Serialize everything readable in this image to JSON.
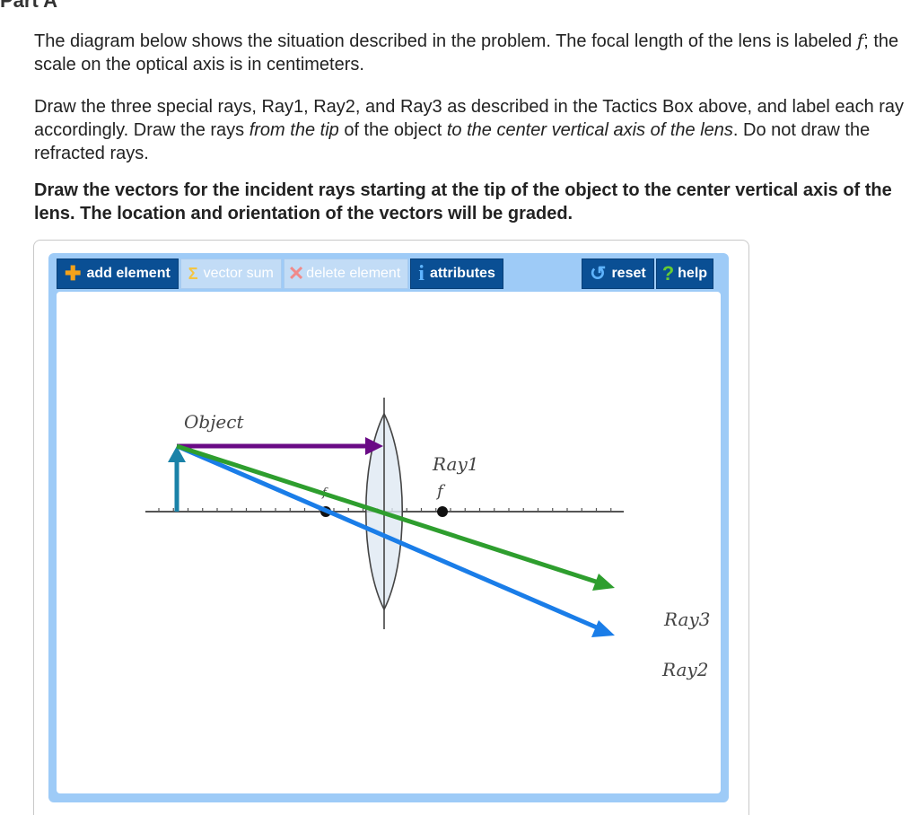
{
  "part_title": "Part A",
  "intro": {
    "s1": "The diagram below shows the situation described in the problem. The focal length of the lens is labeled ",
    "f": "f",
    "s2": "; the scale on the optical axis is in centimeters."
  },
  "instructions": {
    "s1": "Draw the three special rays, Ray1, Ray2, and Ray3 as described in the Tactics Box above, and label each ray accordingly. Draw the rays ",
    "em1": "from the tip",
    "s2": " of the object ",
    "em2": "to the center vertical axis of the lens",
    "s3": ". Do not draw the refracted rays."
  },
  "task": "Draw the vectors for the incident rays starting at the tip of the object to the center vertical axis of the lens. The location and orientation of the vectors will be graded.",
  "toolbar": {
    "add_element": "add element",
    "vector_sum": "vector sum",
    "delete_element": "delete element",
    "attributes": "attributes",
    "reset": "reset",
    "help": "help"
  },
  "diagram": {
    "object_label": "Object",
    "focal_label_left": "f",
    "focal_label_right": "f",
    "ray_labels": [
      "Ray1",
      "Ray3",
      "Ray2"
    ],
    "colors": {
      "object": "#1a82a8",
      "ray_purple": "#6a0a86",
      "ray_green": "#2e9e2e",
      "ray_blue": "#1a7de8",
      "axis": "#555555"
    }
  }
}
